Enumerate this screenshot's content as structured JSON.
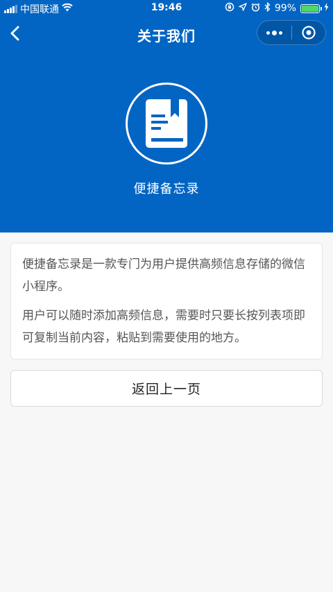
{
  "status_bar": {
    "carrier": "中国联通",
    "time": "19:46",
    "battery_percent": "99%"
  },
  "nav": {
    "title": "关于我们"
  },
  "app": {
    "name": "便捷备忘录"
  },
  "about": {
    "paragraphs": [
      "便捷备忘录是一款专门为用户提供高频信息存储的微信小程序。",
      "用户可以随时添加高频信息，需要时只要长按列表项即可复制当前内容，粘贴到需要使用的地方。"
    ]
  },
  "buttons": {
    "back_page_label": "返回上一页"
  },
  "colors": {
    "header_bg": "#0265c4",
    "page_bg": "#f7f7f7",
    "battery_fill": "#4cd964"
  },
  "icons": [
    "signal-icon",
    "wifi-icon",
    "lock-rotation-icon",
    "location-arrow-icon",
    "alarm-icon",
    "bluetooth-icon",
    "battery-icon",
    "charging-icon",
    "back-arrow-icon",
    "more-icon",
    "close-target-icon",
    "book-icon"
  ]
}
